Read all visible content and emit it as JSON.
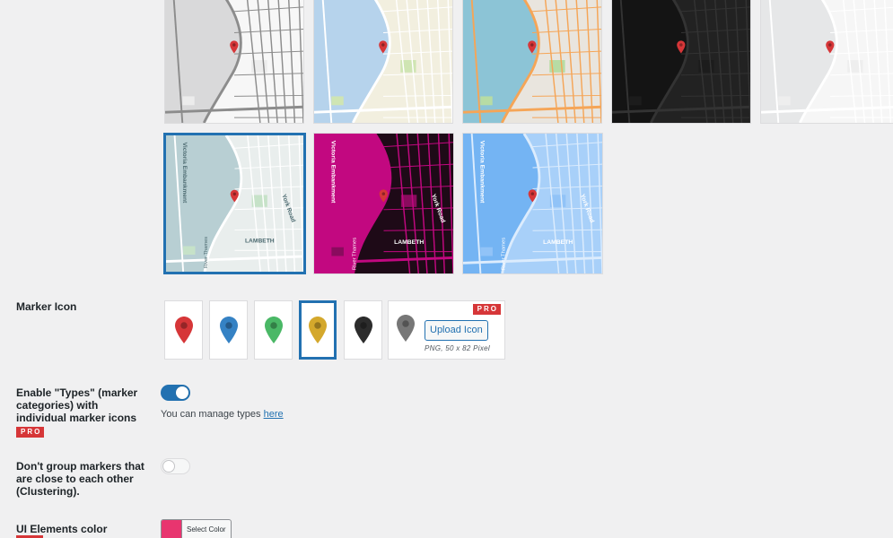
{
  "map_styles": [
    {
      "name": "light-gray",
      "water": "#d9d9da",
      "land": "#f7f7f7",
      "road": "#8c8c8c",
      "park": "#ececec"
    },
    {
      "name": "standard",
      "water": "#b6d3ec",
      "land": "#f2efdf",
      "road": "#ffffff",
      "park": "#cfe5b3"
    },
    {
      "name": "osm-colorful",
      "water": "#8cc4d6",
      "land": "#e9e5de",
      "road": "#f5a557",
      "park": "#b7dca4"
    },
    {
      "name": "dark",
      "water": "#141414",
      "land": "#222222",
      "road": "#333333",
      "park": "#1c1c1c"
    },
    {
      "name": "silver",
      "water": "#e6e7e8",
      "land": "#f6f6f6",
      "road": "#ffffff",
      "park": "#eeeeee"
    },
    {
      "name": "muted-teal",
      "water": "#b8cfd3",
      "land": "#e9eeed",
      "road": "#ffffff",
      "park": "#c6e2c8",
      "labels": [
        "Victoria Embankment",
        "River Thames",
        "York Road",
        "LAMBETH"
      ]
    },
    {
      "name": "magenta",
      "water": "#c20880",
      "land": "#1e0a17",
      "road": "#c20880",
      "park": "#8a0b5e",
      "labels": [
        "Victoria Embankment",
        "River Thames",
        "York Road",
        "LAMBETH"
      ]
    },
    {
      "name": "blueprint",
      "water": "#74b4f3",
      "land": "#a8d0f9",
      "road": "#dcecfd",
      "park": "#91c3f7",
      "labels": [
        "Victoria Embankment",
        "River Thames",
        "York Road",
        "LAMBETH"
      ]
    }
  ],
  "marker_icon": {
    "label": "Marker Icon",
    "colors": [
      "#d63638",
      "#3582c4",
      "#4ab866",
      "#d4a82c",
      "#2c2c2c",
      "#777777"
    ],
    "upload_label": "Upload Icon",
    "upload_hint": "PNG, 50 x 82 Pixel",
    "pro": "PRO"
  },
  "types": {
    "label": "Enable \"Types\" (marker categories) with individual marker icons",
    "pro": "PRO",
    "help_text": "You can manage types ",
    "help_link": "here",
    "enabled": true
  },
  "clustering": {
    "label": "Don't group markers that are close to each other (Clustering).",
    "enabled": false
  },
  "ui_color": {
    "label": "UI Elements color",
    "button": "Select Color",
    "value": "#e8356f"
  }
}
